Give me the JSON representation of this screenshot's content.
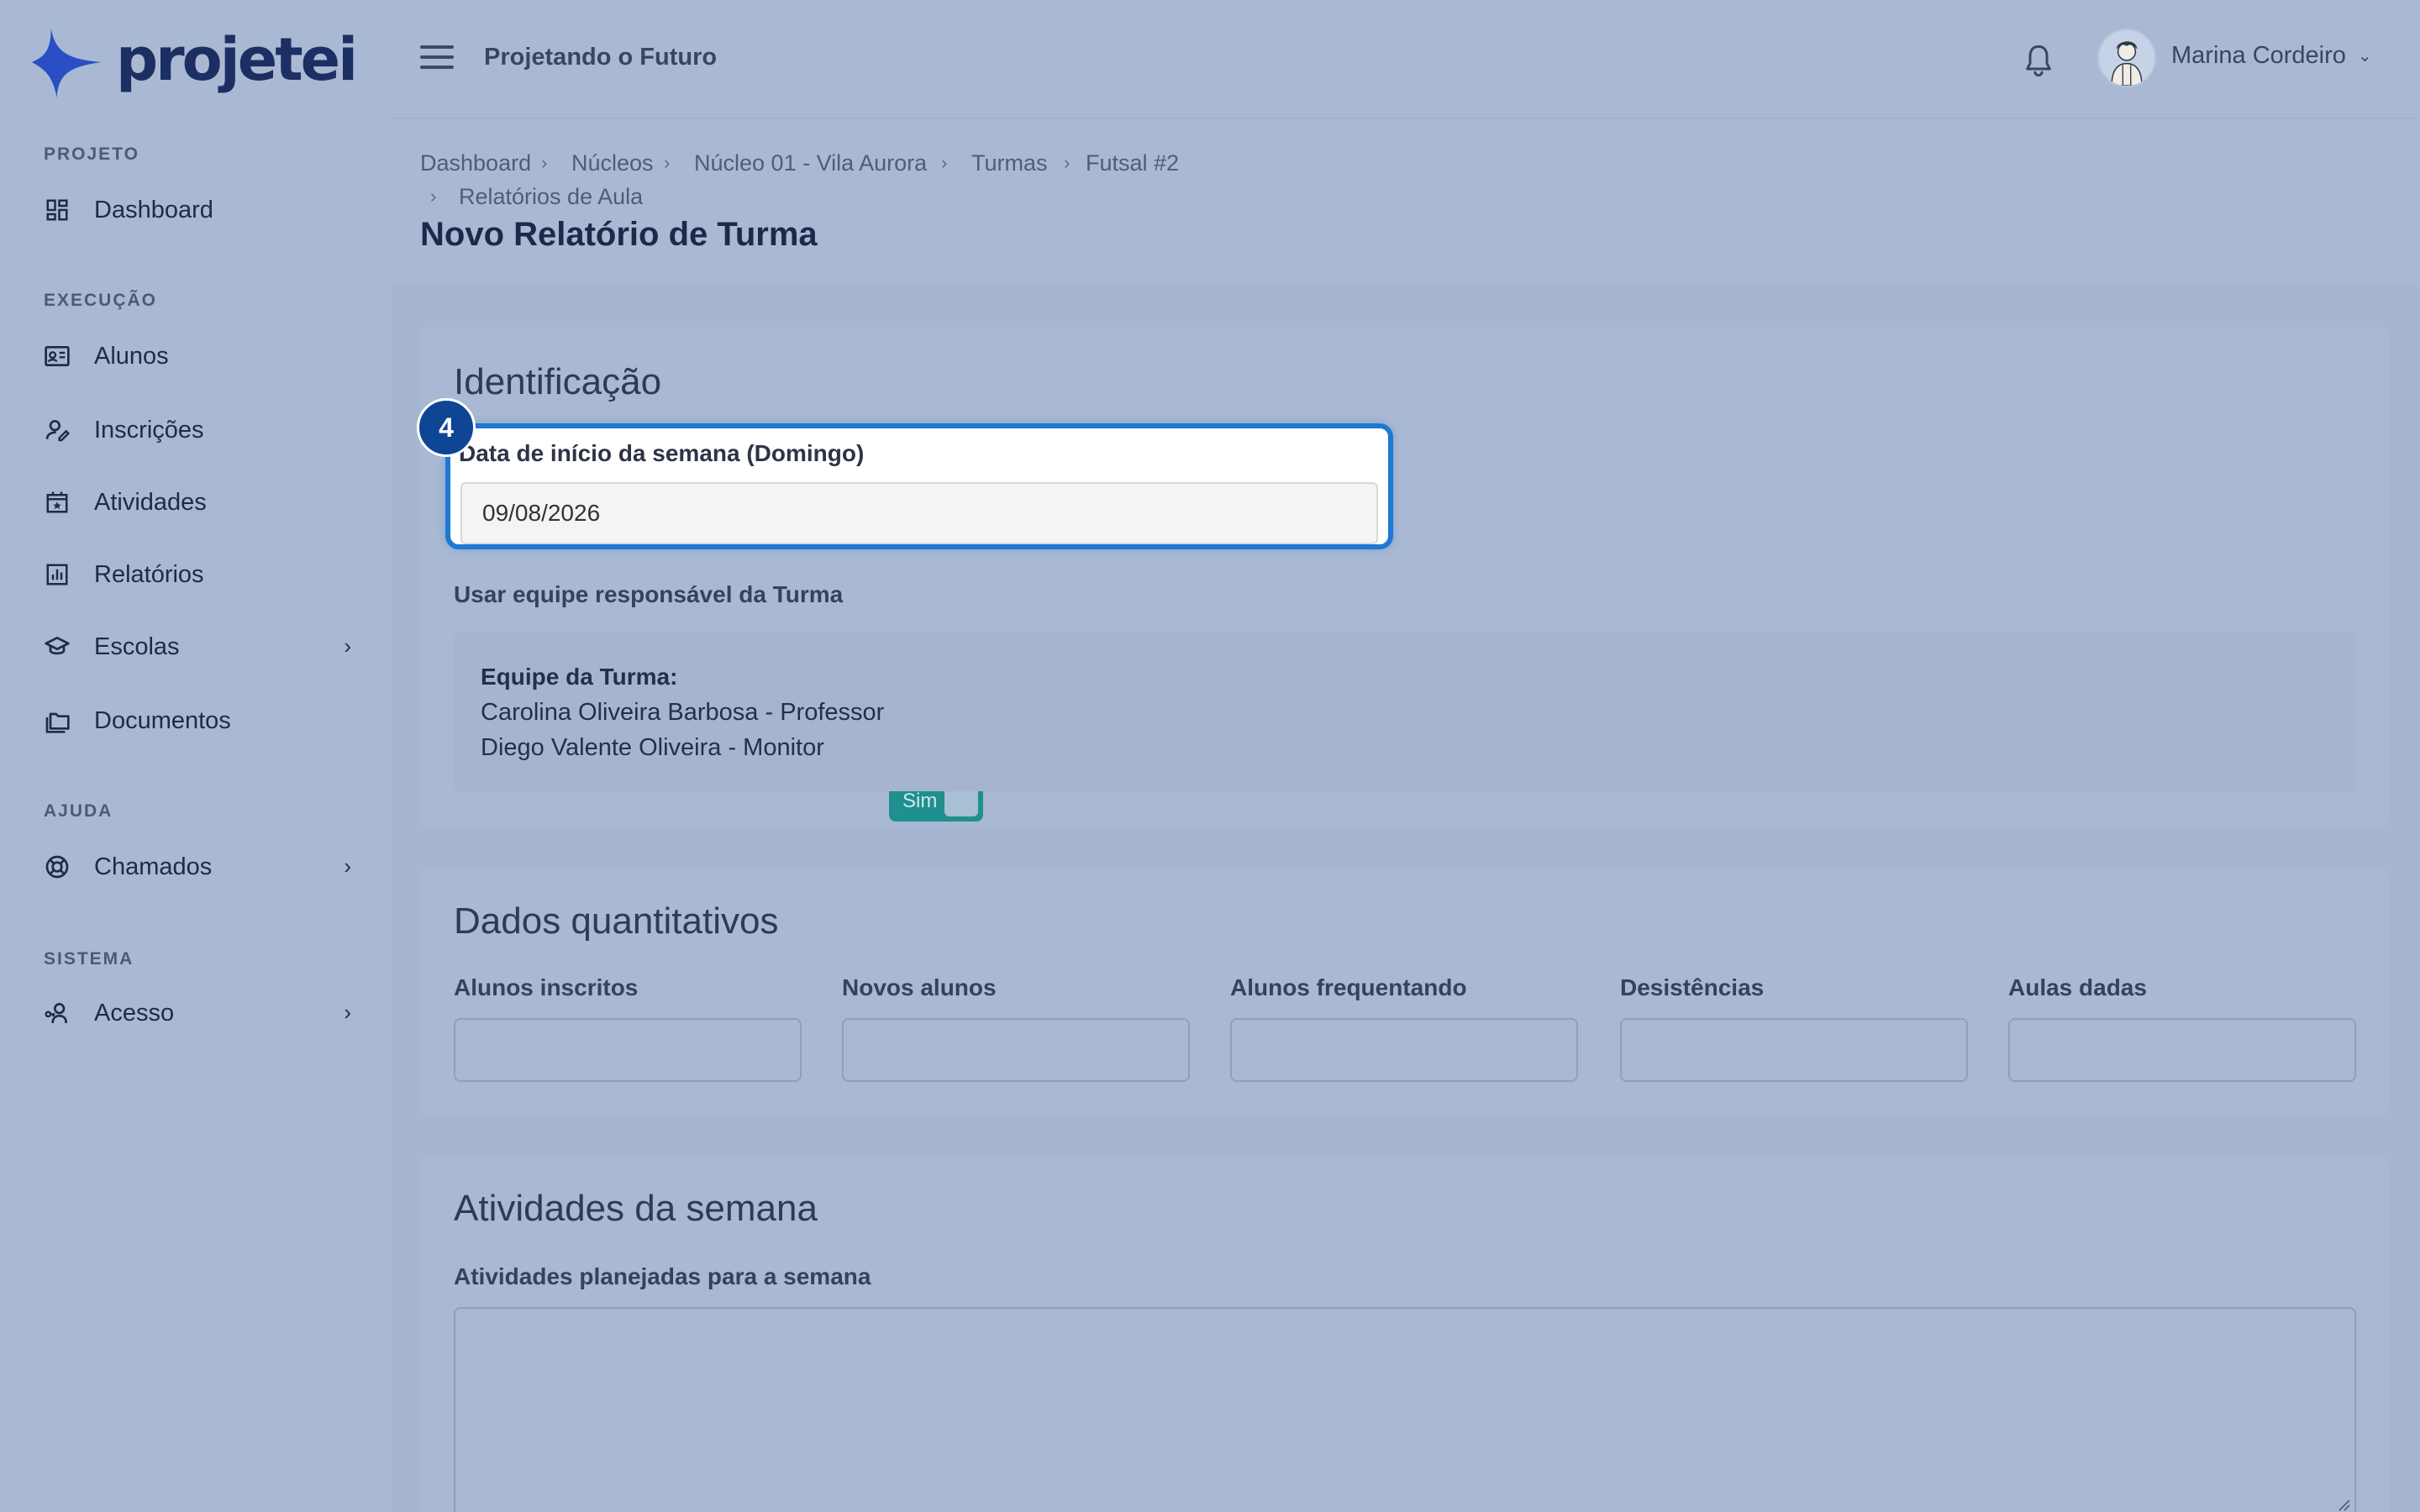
{
  "app": {
    "logo_text": "projetei",
    "project_name": "Projetando o Futuro",
    "user_name": "Marina Cordeiro"
  },
  "sidebar": {
    "sections": [
      {
        "label": "PROJETO"
      },
      {
        "label": "EXECUÇÃO"
      },
      {
        "label": "AJUDA"
      },
      {
        "label": "SISTEMA"
      }
    ],
    "items": [
      {
        "label": "Dashboard",
        "icon": "dashboard-icon"
      },
      {
        "label": "Alunos",
        "icon": "id-card-icon"
      },
      {
        "label": "Inscrições",
        "icon": "user-edit-icon"
      },
      {
        "label": "Atividades",
        "icon": "calendar-star-icon"
      },
      {
        "label": "Relatórios",
        "icon": "bar-chart-icon"
      },
      {
        "label": "Escolas",
        "icon": "graduation-cap-icon"
      },
      {
        "label": "Documentos",
        "icon": "folders-icon"
      },
      {
        "label": "Chamados",
        "icon": "lifebuoy-icon"
      },
      {
        "label": "Acesso",
        "icon": "user-key-icon"
      }
    ]
  },
  "breadcrumb": [
    "Dashboard",
    "Núcleos",
    "Núcleo 01 - Vila Aurora",
    "Turmas",
    "Futsal #2",
    "Relatórios de Aula"
  ],
  "page": {
    "title": "Novo Relatório de Turma"
  },
  "identificacao": {
    "title": "Identificação",
    "step_number": "4",
    "date_label": "Data de início da semana (Domingo)",
    "date_value": "09/08/2026",
    "toggle_label": "Usar equipe responsável da Turma",
    "toggle_value": "Sim",
    "team_title": "Equipe da Turma:",
    "team_members": [
      "Carolina Oliveira Barbosa - Professor",
      "Diego Valente Oliveira - Monitor"
    ]
  },
  "quantitativos": {
    "title": "Dados quantitativos",
    "fields": [
      "Alunos inscritos",
      "Novos alunos",
      "Alunos frequentando",
      "Desistências",
      "Aulas dadas"
    ]
  },
  "atividades": {
    "title": "Atividades da semana",
    "textarea_label": "Atividades planejadas para a semana"
  },
  "colors": {
    "accent": "#1f78d1",
    "toggle_on": "#1f8f8f",
    "badge": "#0e4595",
    "brand": "#1c2f63"
  }
}
